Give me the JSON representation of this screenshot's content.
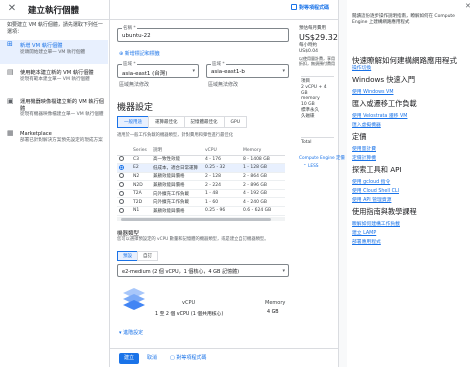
{
  "topbar": {
    "close_icon": "close-icon",
    "title": "建立執行個體",
    "equiv_label": "對等項程式碼"
  },
  "nav": {
    "intro": "如要建立 VM 執行個體，請先選取下列任一選項：",
    "items": [
      {
        "title": "新增 VM 執行個體",
        "sub": "從頭開始建立單一 VM 執行個體",
        "icon": "plus-icon",
        "active": true
      },
      {
        "title": "使用範本建立新的 VM 執行個體",
        "sub": "從現有範本建立單一 VM 執行個體",
        "icon": "template-icon",
        "active": false
      },
      {
        "title": "運用機器映像檔建立新的 VM 執行個體",
        "sub": "從現有機器映像檔建立單一 VM 執行個體",
        "icon": "image-icon",
        "active": false
      },
      {
        "title": "Marketplace",
        "sub": "部署已針對解決方案預先設定的現成方案",
        "icon": "marketplace-icon",
        "active": false
      }
    ]
  },
  "form": {
    "name_label": "名稱 *",
    "name_value": "ubuntu-22",
    "add_labels_link": "新增標記和標籤",
    "region_label": "區域 *",
    "region_value": "asia-east1 (台灣)",
    "zone_label": "區域 *",
    "zone_value": "asia-east1-b",
    "region_note": "區域無法修改",
    "zone_note": "區域無法修改",
    "machine_config_heading": "機器設定",
    "tabs": [
      "一般用途",
      "運算最佳化",
      "記憶體最佳化",
      "GPU"
    ],
    "tab_desc": "適用於一般工作負載的機器類型，針對費用和彈性進行最佳化",
    "table_headers": [
      "",
      "Series",
      "說明",
      "vCPU",
      "Memory",
      ""
    ],
    "table_rows": [
      {
        "series": "C3",
        "desc": "高一致性效能",
        "vcpu": "4 - 176",
        "mem": "8 - 1408 GB",
        "selected": false
      },
      {
        "series": "E2",
        "desc": "低成本，適合日常運算",
        "vcpu": "0.25 - 32",
        "mem": "1 - 128 GB",
        "selected": true
      },
      {
        "series": "N2",
        "desc": "兼顧效能與價格",
        "vcpu": "2 - 128",
        "mem": "2 - 864 GB",
        "selected": false
      },
      {
        "series": "N2D",
        "desc": "兼顧效能與價格",
        "vcpu": "2 - 224",
        "mem": "2 - 896 GB",
        "selected": false
      },
      {
        "series": "T2A",
        "desc": "向外擴充工作負載",
        "vcpu": "1 - 48",
        "mem": "4 - 192 GB",
        "selected": false
      },
      {
        "series": "T2D",
        "desc": "向外擴充工作負載",
        "vcpu": "1 - 60",
        "mem": "4 - 240 GB",
        "selected": false
      },
      {
        "series": "N1",
        "desc": "兼顧效能與價格",
        "vcpu": "0.25 - 96",
        "mem": "0.6 - 624 GB",
        "selected": false
      }
    ],
    "machine_type_heading": "機器類型",
    "machine_type_desc": "您可以選擇預設定的 vCPU 數量和記憶體的機器類型，或是建立自訂機器類型。",
    "preset_tabs": [
      "預設",
      "自訂"
    ],
    "machine_type_value": "e2-medium (2 個 vCPU，1 個核心，4 GB 記憶體)",
    "vcpu_label": "vCPU",
    "vcpu_value": "1 至 2 個 vCPU (1 個共用核心)",
    "memory_label": "Memory",
    "memory_value": "4 GB",
    "advanced_link": "進階設定"
  },
  "cost": {
    "label": "預估每月費用",
    "amount": "US$29.32",
    "hourly": "每小時約 US$0.04",
    "usage_note": "以使用量計費，享用折扣，無須預付費用",
    "items_label": "項目",
    "items": [
      "2 vCPU + 4 GB",
      "memory",
      "10 GB",
      "標準永久",
      "久磁碟"
    ],
    "total_label": "Total",
    "pricing_link": "Compute Engine 定價",
    "less_link": "LESS"
  },
  "bottom": {
    "create_button": "建立",
    "cancel_button": "取消",
    "equiv_label": "對等項程式碼"
  },
  "help": {
    "close_icon": "close-icon",
    "title": "快速瞭解如何建構網路應用程式",
    "desc": "閱讀這份逐步操作說明指南，瞭解如何在 Compute Engine 上建構網路應用程式",
    "sections": [
      {
        "heading": "",
        "links": [
          "操作切換"
        ]
      },
      {
        "heading": "Windows 快速入門",
        "links": [
          "使用 Windows VM"
        ]
      },
      {
        "heading": "匯入或遷移工作負載",
        "links": [
          "使用 Velostrata 遷移 VM",
          "匯入虛擬機器"
        ]
      },
      {
        "heading": "定價",
        "links": [
          "使用量計費",
          "定價計算機"
        ]
      },
      {
        "heading": "探索工具和 API",
        "links": [
          "使用 gcloud 指令",
          "使用 Cloud Shell CLI",
          "使用 API 管理資源"
        ]
      },
      {
        "heading": "使用指南與教學課程",
        "links": [
          "瞭解如何建構工作負載",
          "建立 LAMP",
          "部署應用程式"
        ]
      }
    ]
  }
}
